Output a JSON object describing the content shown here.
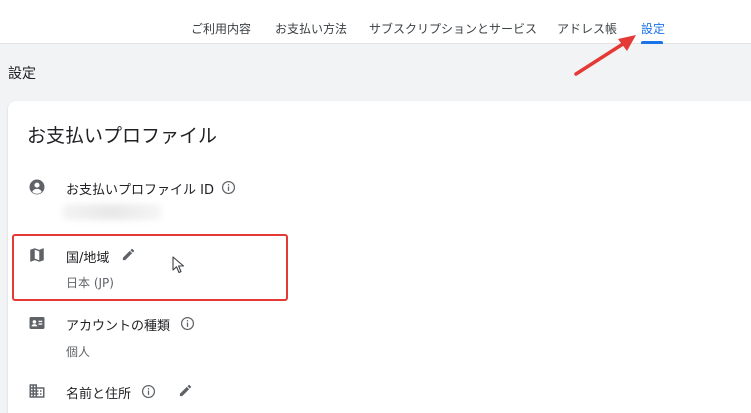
{
  "tabs": [
    {
      "label": "ご利用内容"
    },
    {
      "label": "お支払い方法"
    },
    {
      "label": "サブスクリプションとサービス"
    },
    {
      "label": "アドレス帳"
    },
    {
      "label": "設定",
      "active": true
    }
  ],
  "page": {
    "title": "設定"
  },
  "card": {
    "title": "お支払いプロファイル",
    "rows": {
      "profile_id": {
        "label": "お支払いプロファイル ID",
        "icon": "account-circle-icon"
      },
      "country": {
        "label": "国/地域",
        "value": "日本 (JP)",
        "icon": "map-icon"
      },
      "account_type": {
        "label": "アカウントの種類",
        "value": "個人",
        "icon": "badge-icon"
      },
      "name_address": {
        "label": "名前と住所",
        "icon": "business-icon"
      }
    }
  },
  "colors": {
    "accent": "#1a73e8",
    "highlight": "#e53935"
  }
}
